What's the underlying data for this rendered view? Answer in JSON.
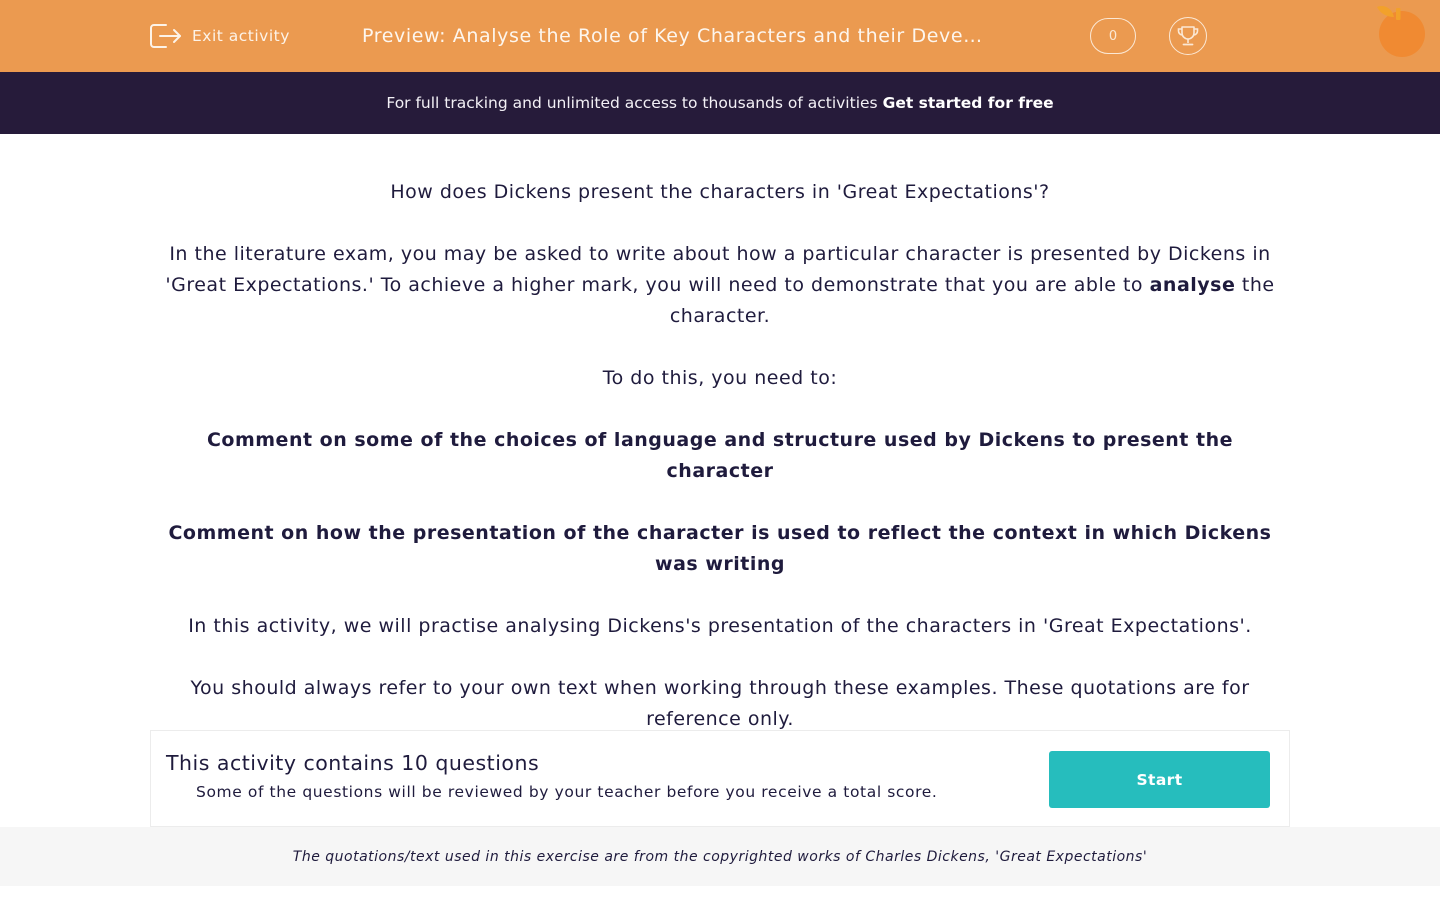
{
  "header": {
    "exit_label": "Exit activity",
    "title": "Preview: Analyse the Role of Key Characters and their Development in 'Great Expectations'",
    "score": "0",
    "icons": {
      "exit": "exit-icon",
      "trophy": "trophy-icon",
      "logo": "orange-logo-icon"
    },
    "colors": {
      "header_bg": "#eb9a50",
      "banner_bg": "#261b3a",
      "accent": "#26bdbd"
    }
  },
  "banner": {
    "text": "For full tracking and unlimited access to thousands of activities",
    "link": "Get started for free"
  },
  "intro": {
    "question": "How does Dickens present the characters in 'Great Expectations'?",
    "para1_before": "In the literature exam, you may be asked to write about how a particular character is presented by Dickens in 'Great Expectations.' To achieve a higher mark, you will need to demonstrate that you are able to ",
    "para1_bold": "analyse",
    "para1_after": " the character.",
    "need": "To do this, you need to:",
    "point1": "Comment on some of the choices of language and structure used by Dickens to present the character",
    "point2": "Comment on how the presentation of the character is used to reflect the context in which Dickens was writing",
    "practise": "In this activity, we will practise analysing Dickens's presentation of the characters in 'Great Expectations'.",
    "reference": "You should always refer to your own text when working through these examples. These quotations are for reference only."
  },
  "activity": {
    "count_text": "This activity contains 10 questions",
    "note": "Some of the questions will be reviewed by your teacher before you receive a total score.",
    "start_label": "Start"
  },
  "footer": {
    "copyright": "The quotations/text used in this exercise are from the copyrighted works of Charles Dickens, 'Great Expectations'"
  }
}
